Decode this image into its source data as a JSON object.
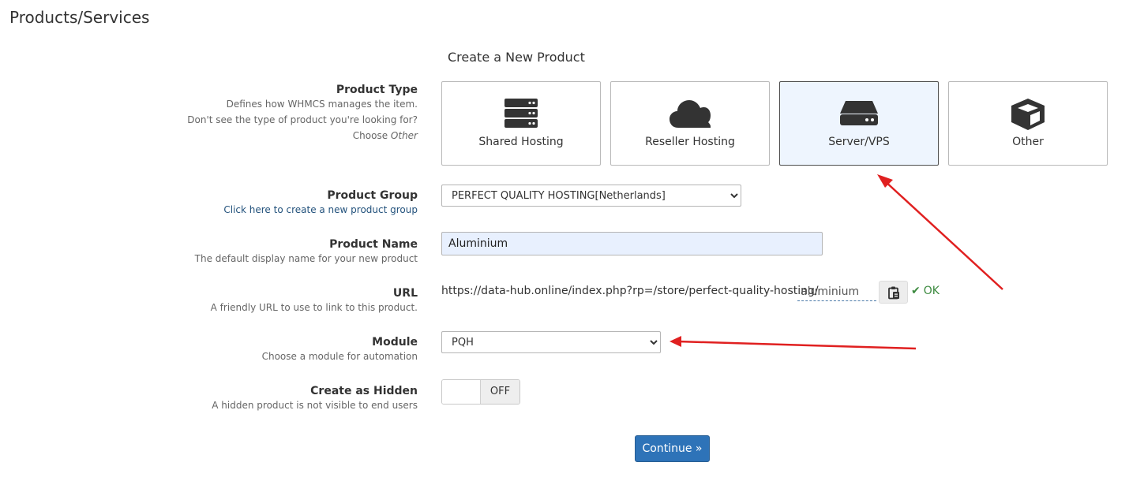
{
  "page": {
    "title": "Products/Services"
  },
  "form": {
    "heading": "Create a New Product",
    "product_type": {
      "label": "Product Type",
      "help_1": "Defines how WHMCS manages the item.",
      "help_2": "Don't see the type of product you're looking for?",
      "help_3_prefix": "Choose ",
      "help_3_emphasis": "Other",
      "options": [
        {
          "label": "Shared Hosting",
          "icon": "server-stack-icon",
          "selected": false
        },
        {
          "label": "Reseller Hosting",
          "icon": "cloud-icon",
          "selected": false
        },
        {
          "label": "Server/VPS",
          "icon": "hard-drive-icon",
          "selected": true
        },
        {
          "label": "Other",
          "icon": "cube-icon",
          "selected": false
        }
      ]
    },
    "product_group": {
      "label": "Product Group",
      "link": "Click here to create a new product group",
      "value": "PERFECT QUALITY HOSTING[Netherlands]"
    },
    "product_name": {
      "label": "Product Name",
      "help": "The default display name for your new product",
      "value": "Aluminium"
    },
    "url": {
      "label": "URL",
      "help": "A friendly URL to use to link to this product.",
      "prefix": "https://data-hub.online/index.php?rp=/store/perfect-quality-hosting/",
      "slug": "aluminium",
      "status": "OK"
    },
    "module": {
      "label": "Module",
      "help": "Choose a module for automation",
      "value": "PQH"
    },
    "hidden": {
      "label": "Create as Hidden",
      "help": "A hidden product is not visible to end users",
      "state": "OFF"
    },
    "continue_label": "Continue »"
  },
  "colors": {
    "primary": "#2e73b8",
    "selected_card_bg": "#eef5fe",
    "ok_green": "#3c8a3f",
    "annotation_arrow": "#e02020"
  }
}
